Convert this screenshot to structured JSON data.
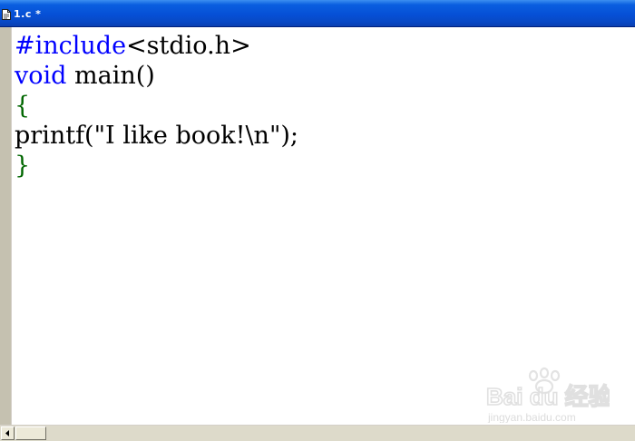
{
  "titlebar": {
    "title": "1.c *",
    "icon": "document-icon"
  },
  "editor": {
    "lines": [
      {
        "parts": [
          {
            "text": "#include",
            "role": "keyword"
          },
          {
            "text": "<stdio.h>",
            "role": "plain"
          }
        ]
      },
      {
        "parts": [
          {
            "text": "void",
            "role": "keyword"
          },
          {
            "text": " main()",
            "role": "plain"
          }
        ]
      },
      {
        "parts": [
          {
            "text": "{",
            "role": "brace"
          }
        ]
      },
      {
        "parts": [
          {
            "text": "printf(\"I like book!\\n\");",
            "role": "plain"
          }
        ]
      },
      {
        "parts": [
          {
            "text": "}",
            "role": "brace"
          }
        ]
      }
    ]
  },
  "scrollbar": {
    "left_arrow": "◂"
  },
  "watermark": {
    "brand": "Bai du 经验",
    "url": "jingyan.baidu.com"
  },
  "colors": {
    "titlebar": "#0650d6",
    "keyword": "#0000ff",
    "brace": "#006600",
    "text": "#000000"
  }
}
